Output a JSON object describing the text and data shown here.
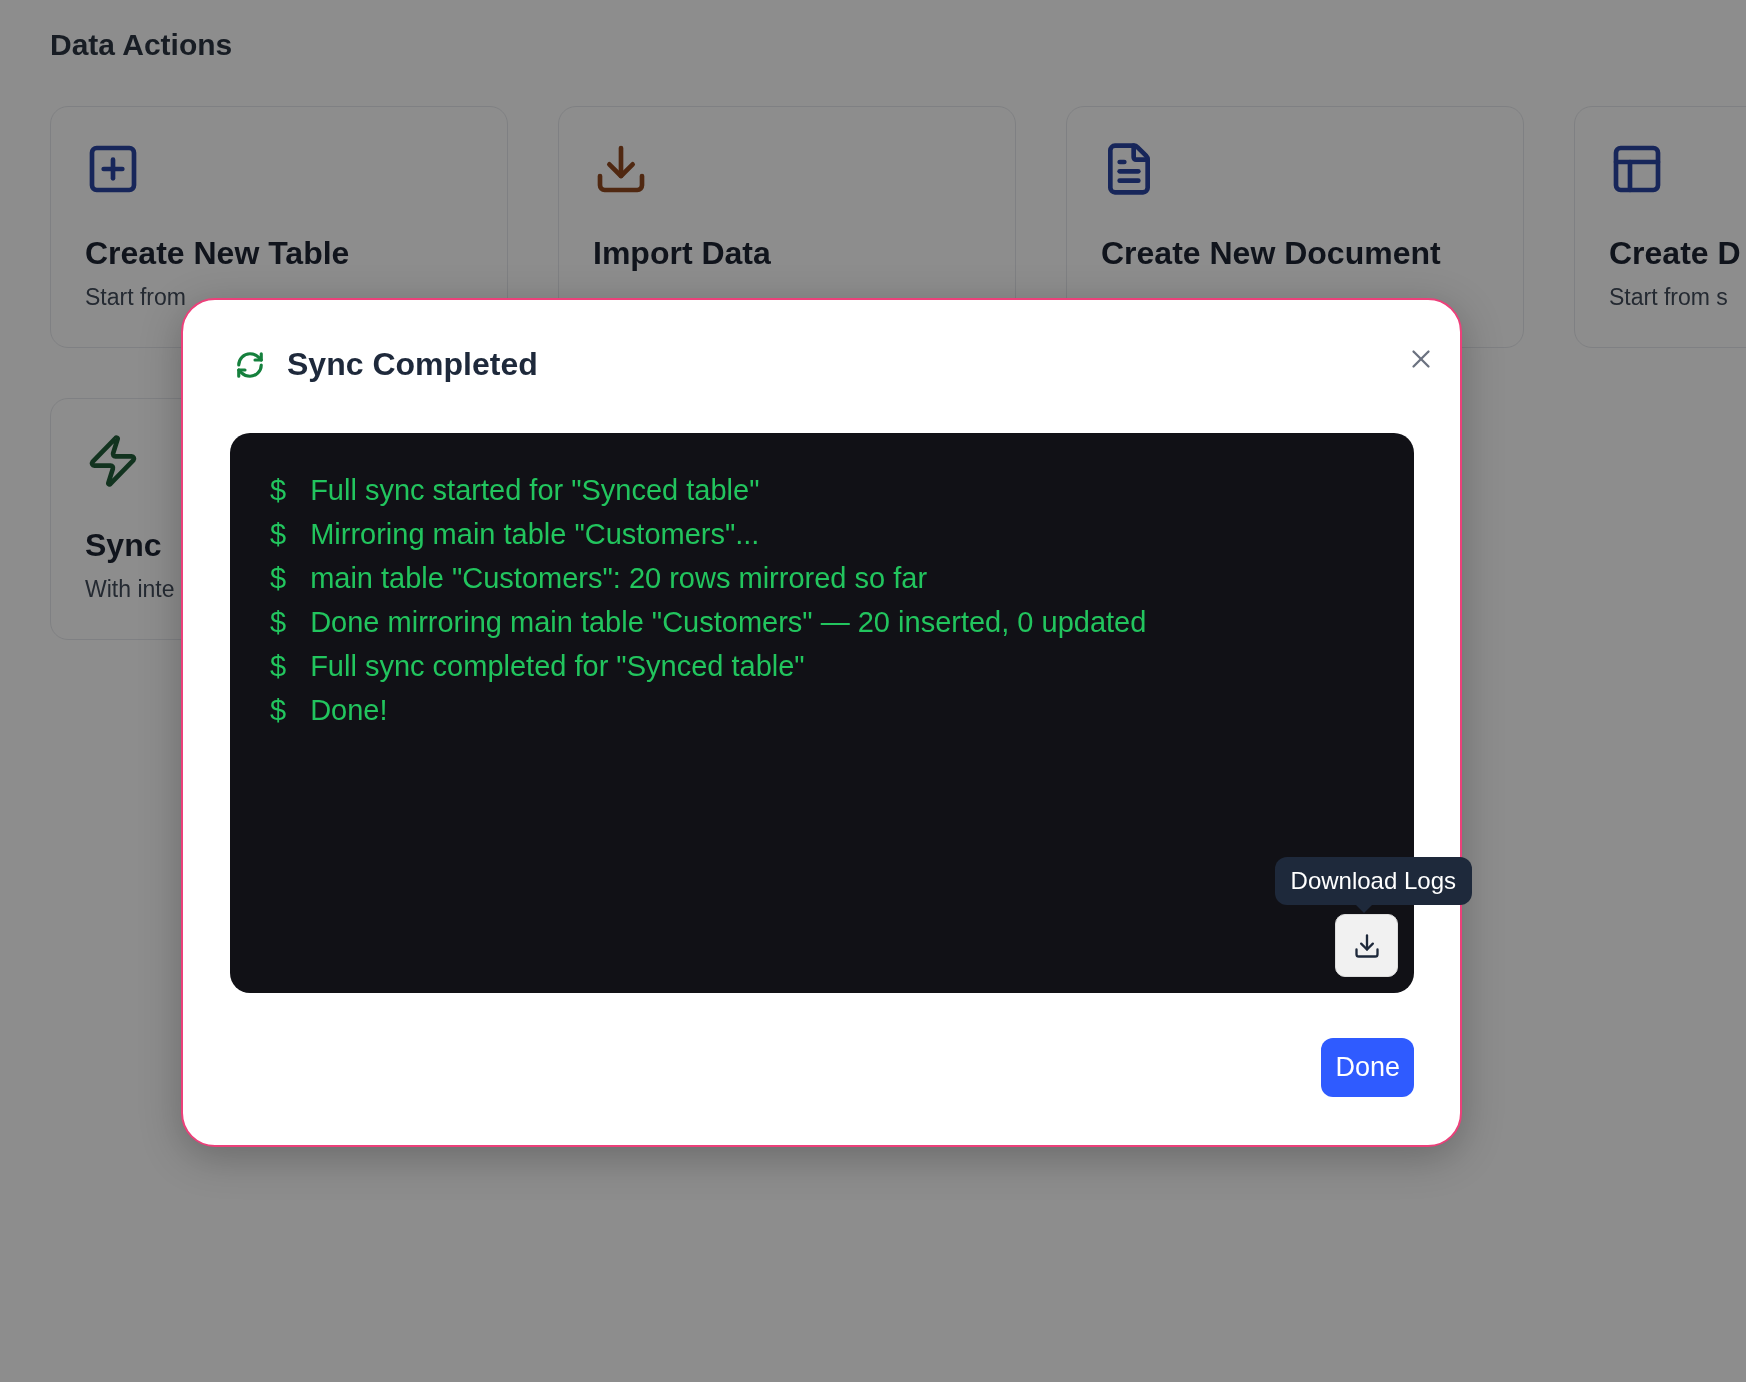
{
  "page": {
    "title": "Data Actions"
  },
  "cards": [
    {
      "kind": "table",
      "title": "Create New Table",
      "subtitle": "Start from"
    },
    {
      "kind": "import",
      "title": "Import Data"
    },
    {
      "kind": "document",
      "title": "Create New Document"
    },
    {
      "kind": "layout",
      "title": "Create D",
      "subtitle": "Start from s"
    },
    {
      "kind": "sync",
      "title": "Sync",
      "subtitle": "With inte"
    }
  ],
  "dialog": {
    "title": "Sync Completed",
    "log_prompt": "$",
    "log_lines": [
      "Full sync started for \"Synced table\"",
      "Mirroring main table \"Customers\"...",
      "main table \"Customers\": 20 rows mirrored so far",
      "Done mirroring main table \"Customers\" — 20 inserted, 0 updated",
      "Full sync completed for \"Synced table\"",
      "Done!"
    ],
    "tooltip": "Download Logs",
    "button": "Done"
  }
}
